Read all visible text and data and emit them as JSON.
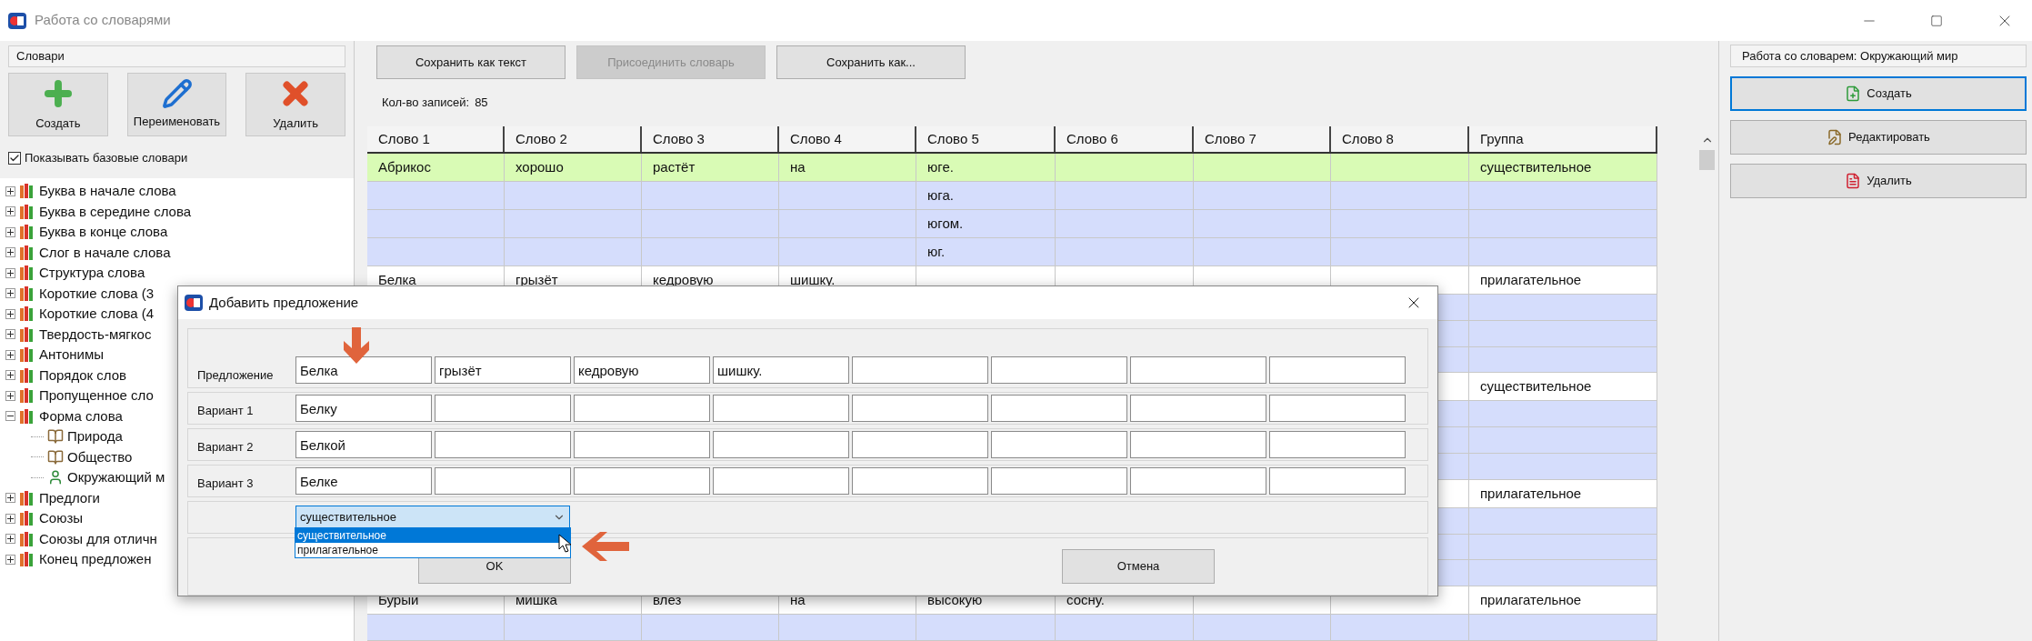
{
  "window": {
    "title": "Работа со словарями"
  },
  "dictionaries": {
    "header": "Словари",
    "buttons": [
      {
        "kind": "create",
        "label": "Создать"
      },
      {
        "kind": "rename",
        "label": "Переименовать"
      },
      {
        "kind": "delete",
        "label": "Удалить"
      }
    ],
    "show_base": {
      "label": "Показывать базовые словари",
      "checked": true
    },
    "tree": [
      {
        "label": "Буква в начале слова",
        "expanded": false
      },
      {
        "label": "Буква в середине слова",
        "expanded": false
      },
      {
        "label": "Буква в конце слова",
        "expanded": false
      },
      {
        "label": "Слог в начале слова",
        "expanded": false
      },
      {
        "label": "Структура слова",
        "expanded": false
      },
      {
        "label": "Короткие слова (3",
        "expanded": false
      },
      {
        "label": "Короткие слова (4",
        "expanded": false
      },
      {
        "label": "Твердость-мягкос",
        "expanded": false
      },
      {
        "label": "Антонимы",
        "expanded": false
      },
      {
        "label": "Порядок слов",
        "expanded": false
      },
      {
        "label": "Пропущенное сло",
        "expanded": false
      },
      {
        "label": "Форма слова",
        "expanded": true,
        "children": [
          {
            "label": "Природа",
            "selected": false
          },
          {
            "label": "Общество",
            "selected": false
          },
          {
            "label": "Окружающий м",
            "selected": true
          }
        ]
      },
      {
        "label": "Предлоги",
        "expanded": false
      },
      {
        "label": "Союзы",
        "expanded": false
      },
      {
        "label": "Союзы для отличн",
        "expanded": false
      },
      {
        "label": "Конец предложен",
        "expanded": false
      }
    ]
  },
  "toolbar": [
    {
      "label": "Сохранить как текст",
      "disabled": false
    },
    {
      "label": "Присоединить словарь",
      "disabled": true
    },
    {
      "label": "Сохранить как...",
      "disabled": false
    }
  ],
  "record_count": {
    "label": "Кол-во записей:",
    "value": "85"
  },
  "table": {
    "columns": [
      "Слово 1",
      "Слово 2",
      "Слово 3",
      "Слово 4",
      "Слово 5",
      "Слово 6",
      "Слово 7",
      "Слово 8",
      "Группа"
    ],
    "rows": [
      {
        "kind": "sentence",
        "selected": true,
        "words": {
          "word_1": "Абрикос",
          "word_2": "хорошо",
          "word_3": "растёт",
          "word_4": "на",
          "word_5": "юге."
        },
        "group": "существительное"
      },
      {
        "kind": "variant",
        "selected": false,
        "words": {
          "word_5": "юга."
        }
      },
      {
        "kind": "variant",
        "selected": false,
        "words": {
          "word_5": "югом."
        }
      },
      {
        "kind": "variant",
        "selected": false,
        "words": {
          "word_5": "юг."
        }
      },
      {
        "kind": "sentence",
        "selected": false,
        "words": {
          "word_1": "Белка",
          "word_2": "грызёт",
          "word_3": "кедровую",
          "word_4": "шишку."
        },
        "group": "прилагательное"
      },
      {
        "kind": "variant",
        "selected": false
      },
      {
        "kind": "variant",
        "selected": false
      },
      {
        "kind": "variant",
        "selected": false
      },
      {
        "kind": "sentence",
        "selected": false,
        "group": "существительное"
      },
      {
        "kind": "variant",
        "selected": false
      },
      {
        "kind": "variant",
        "selected": false
      },
      {
        "kind": "variant",
        "selected": false
      },
      {
        "kind": "sentence",
        "selected": false,
        "group": "прилагательное"
      },
      {
        "kind": "variant",
        "selected": false
      },
      {
        "kind": "variant",
        "selected": false
      },
      {
        "kind": "variant",
        "selected": false
      },
      {
        "kind": "sentence",
        "selected": false,
        "words": {
          "word_1": "Бурый",
          "word_2": "мишка",
          "word_3": "влез",
          "word_4": "на",
          "word_5": "высокую",
          "word_6": "сосну."
        },
        "group": "прилагательное"
      },
      {
        "kind": "variant",
        "selected": false
      }
    ]
  },
  "dictionary_panel": {
    "header": "Работа со словарем: Окружающий мир",
    "buttons": [
      {
        "kind": "create",
        "label": "Создать",
        "focused": true
      },
      {
        "kind": "edit",
        "label": "Редактировать",
        "focused": false
      },
      {
        "kind": "delete",
        "label": "Удалить",
        "focused": false
      }
    ]
  },
  "dialog": {
    "title": "Добавить предложение",
    "rows": [
      {
        "label": "Предложение",
        "values": {
          "word_1": "Белка",
          "word_2": "грызёт",
          "word_3": "кедровую",
          "word_4": "шишку."
        }
      },
      {
        "label": "Вариант 1",
        "values": {
          "word_1": "Белку"
        }
      },
      {
        "label": "Вариант 2",
        "values": {
          "word_1": "Белкой"
        }
      },
      {
        "label": "Вариант 3",
        "values": {
          "word_1": "Белке"
        }
      }
    ],
    "group": {
      "value": "существительное",
      "expanded": true,
      "options": [
        {
          "label": "существительное",
          "selected": true
        },
        {
          "label": "прилагательное",
          "selected": false
        }
      ]
    },
    "buttons": [
      "OK",
      "Отмена"
    ]
  }
}
